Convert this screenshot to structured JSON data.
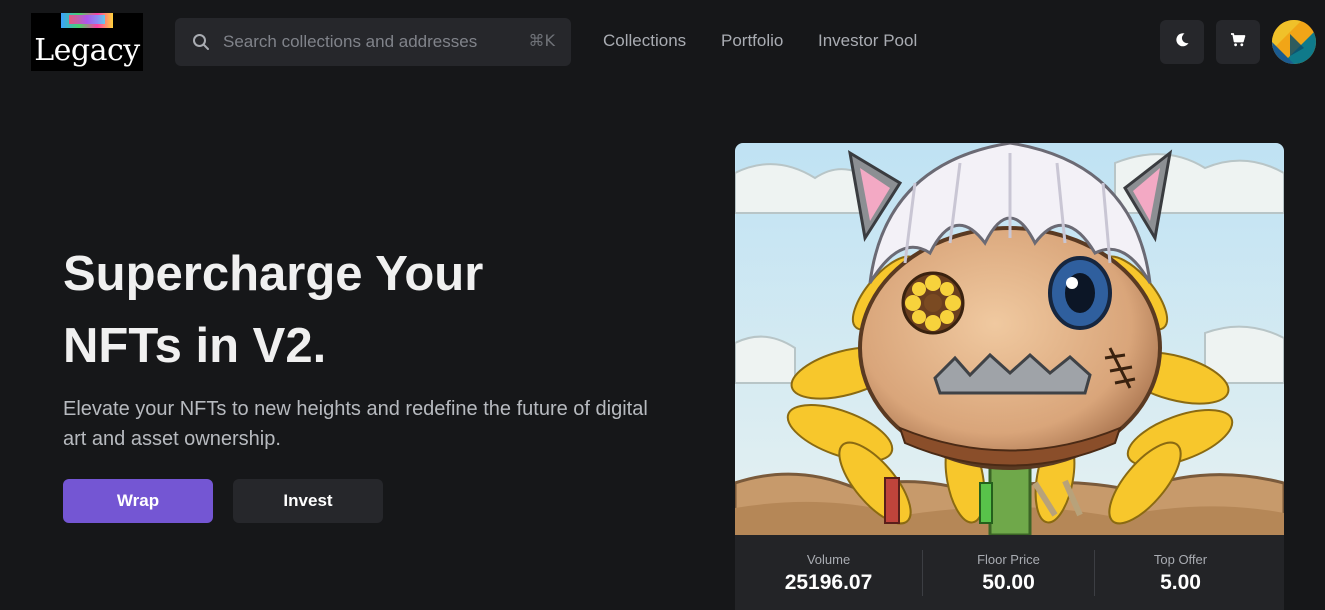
{
  "header": {
    "logo_text": "Legacy",
    "search": {
      "placeholder": "Search collections and addresses",
      "shortcut": "⌘K",
      "icon": "search-icon"
    },
    "nav": [
      {
        "label": "Collections"
      },
      {
        "label": "Portfolio"
      },
      {
        "label": "Investor Pool"
      }
    ],
    "actions": {
      "theme_icon": "moon-icon",
      "cart_icon": "cart-icon",
      "avatar_icon": "avatar"
    }
  },
  "hero": {
    "title_line1": "Supercharge Your",
    "title_line2": "NFTs in V2.",
    "subtitle": "Elevate your NFTs to new heights and redefine the future of digital art and asset ownership.",
    "buttons": {
      "wrap_label": "Wrap",
      "invest_label": "Invest"
    }
  },
  "featured_nft": {
    "stats": [
      {
        "label": "Volume",
        "value": "25196.07"
      },
      {
        "label": "Floor Price",
        "value": "50.00"
      },
      {
        "label": "Top Offer",
        "value": "5.00"
      }
    ]
  },
  "colors": {
    "background": "#161719",
    "surface": "#26272b",
    "accent": "#7456d3",
    "muted_text": "#a9acb2"
  }
}
